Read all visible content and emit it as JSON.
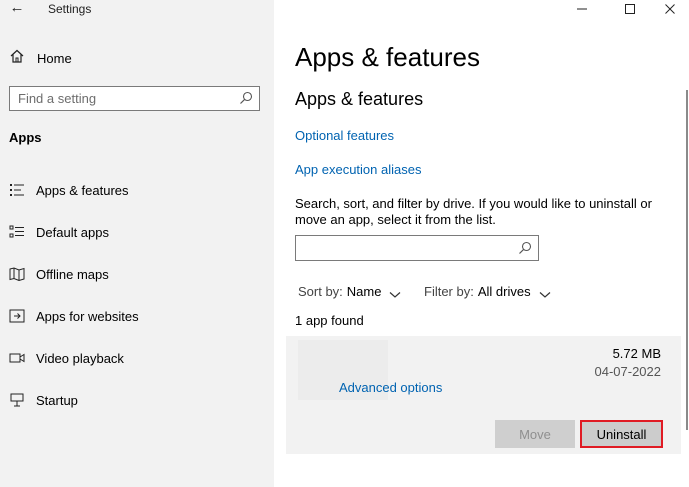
{
  "window": {
    "title": "Settings",
    "back_icon": "back-arrow-icon",
    "minimize_icon": "minimize-icon",
    "maximize_icon": "maximize-icon",
    "close_icon": "close-icon"
  },
  "sidebar": {
    "home_label": "Home",
    "search_placeholder": "Find a setting",
    "section_title": "Apps",
    "items": [
      {
        "label": "Apps & features",
        "icon": "apps-features-icon"
      },
      {
        "label": "Default apps",
        "icon": "default-apps-icon"
      },
      {
        "label": "Offline maps",
        "icon": "offline-maps-icon"
      },
      {
        "label": "Apps for websites",
        "icon": "apps-for-websites-icon"
      },
      {
        "label": "Video playback",
        "icon": "video-playback-icon"
      },
      {
        "label": "Startup",
        "icon": "startup-icon"
      }
    ]
  },
  "main": {
    "page_title": "Apps & features",
    "section_title": "Apps & features",
    "links": {
      "optional_features": "Optional features",
      "app_execution_aliases": "App execution aliases"
    },
    "description": "Search, sort, and filter by drive. If you would like to uninstall or move an app, select it from the list.",
    "search_value": "",
    "sort": {
      "label": "Sort by:",
      "value": "Name"
    },
    "filter": {
      "label": "Filter by:",
      "value": "All drives"
    },
    "count_text": "1 app found",
    "app": {
      "size": "5.72 MB",
      "date": "04-07-2022",
      "advanced_options": "Advanced options",
      "move_label": "Move",
      "uninstall_label": "Uninstall"
    }
  },
  "colors": {
    "link": "#0063b1",
    "sidebar_bg": "#f2f2f2",
    "highlight_border": "#e01b24"
  }
}
